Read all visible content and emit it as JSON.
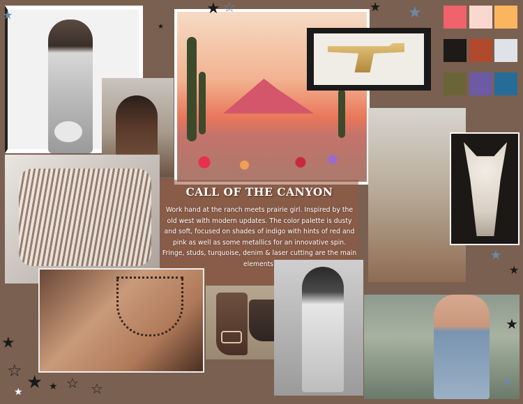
{
  "board": {
    "title": "CALL OF THE CANYON",
    "description": "Work hand at the ranch meets prairie girl. Inspired by the old west with modern updates. The color palette is dusty and soft, focused on shades of indigo with hints of red and pink as well as some metallics for an innovative spin. Fringe, studs, turquoise, denim & laser cutting are the main elements."
  },
  "palette": [
    "#f0636d",
    "#fbd8cf",
    "#fbb55e",
    "#1e1a18",
    "#b14a2c",
    "#dfe3e9",
    "#6a6538",
    "#6c5aa4",
    "#266c98"
  ],
  "colors": {
    "background": "#7a6050",
    "text_panel": "#a0603f",
    "title_text": "#ffffff"
  }
}
